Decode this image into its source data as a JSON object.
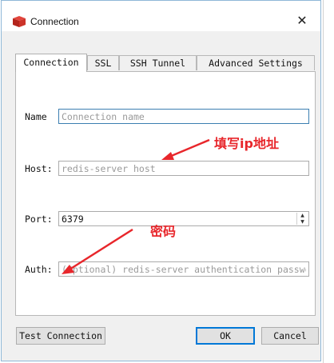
{
  "window": {
    "title": "Connection",
    "accent": "#c0392b"
  },
  "tabs": [
    {
      "label": "Connection",
      "active": true
    },
    {
      "label": "SSL",
      "active": false
    },
    {
      "label": "SSH Tunnel",
      "active": false
    },
    {
      "label": "Advanced Settings",
      "active": false
    }
  ],
  "form": {
    "name_label": "Name",
    "name_placeholder": "Connection name",
    "host_label": "Host:",
    "host_placeholder": "redis-server host",
    "port_label": "Port:",
    "port_value": "6379",
    "auth_label": "Auth:",
    "auth_placeholder": "(Optional) redis-server authentication password"
  },
  "buttons": {
    "test": "Test Connection",
    "ok": "OK",
    "cancel": "Cancel"
  },
  "annotations": {
    "host_note": "填写ip地址",
    "auth_note": "密码",
    "color": "#e8262b"
  },
  "icons": {
    "app": "redis-cube-icon",
    "close": "close-icon"
  }
}
